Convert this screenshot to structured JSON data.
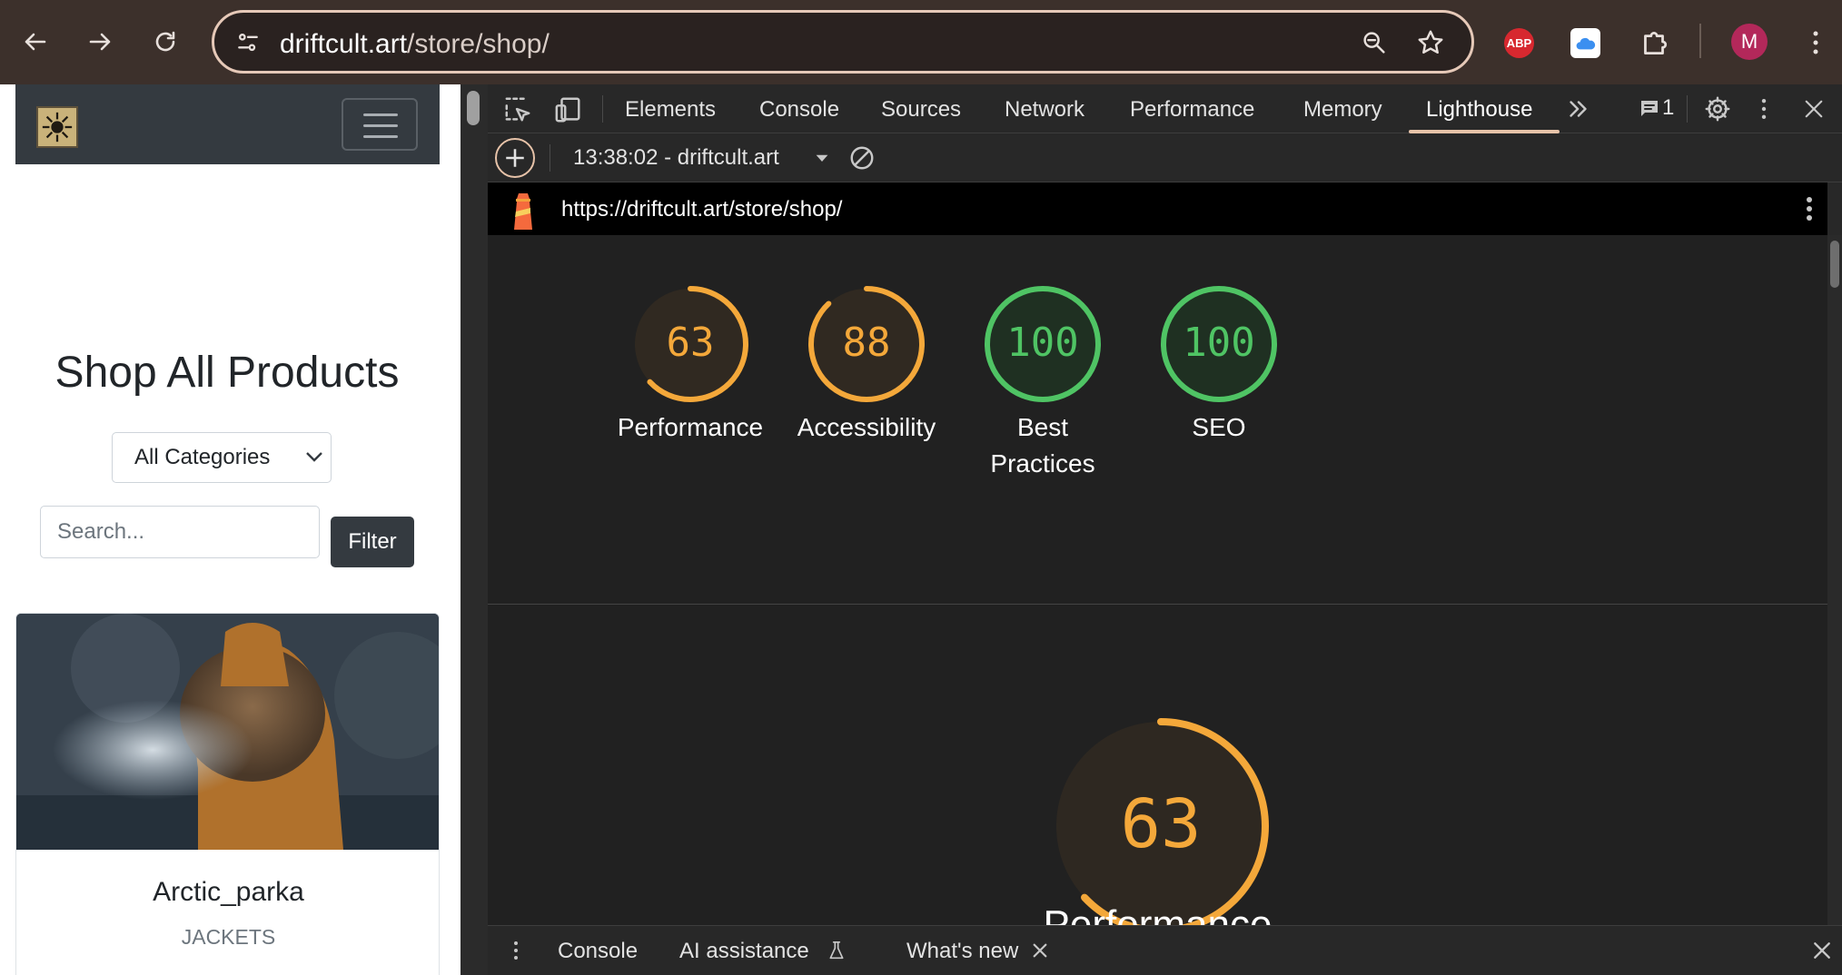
{
  "browser": {
    "url_host": "driftcult.art",
    "url_path": "/store/shop/",
    "profile_initial": "M",
    "abp_label": "ABP",
    "colors": {
      "chrome_bg": "#3c302b",
      "profile": "#b3285a",
      "abp": "#d7282f"
    }
  },
  "site": {
    "title": "Shop All Products",
    "category_select": "All Categories",
    "search_placeholder": "Search...",
    "filter_label": "Filter",
    "product": {
      "name": "Arctic_parka",
      "category": "JACKETS"
    }
  },
  "devtools": {
    "tabs": [
      "Elements",
      "Console",
      "Sources",
      "Network",
      "Performance",
      "Memory",
      "Lighthouse"
    ],
    "active_tab": "Lighthouse",
    "issues_count": "1",
    "report_select": "13:38:02 - driftcult.art",
    "report_url": "https://driftcult.art/store/shop/",
    "scores": [
      {
        "label": "Performance",
        "value": 63,
        "color": "#f4a83a"
      },
      {
        "label": "Accessibility",
        "value": 88,
        "color": "#f4a83a"
      },
      {
        "label": "Best Practices",
        "value": 100,
        "color": "#4fc464"
      },
      {
        "label": "SEO",
        "value": 100,
        "color": "#4fc464"
      }
    ],
    "big_gauge": {
      "label": "Performance",
      "value": 63,
      "color": "#f4a83a"
    },
    "drawer_tabs": {
      "console": "Console",
      "ai": "AI assistance",
      "whats_new": "What's new"
    }
  }
}
